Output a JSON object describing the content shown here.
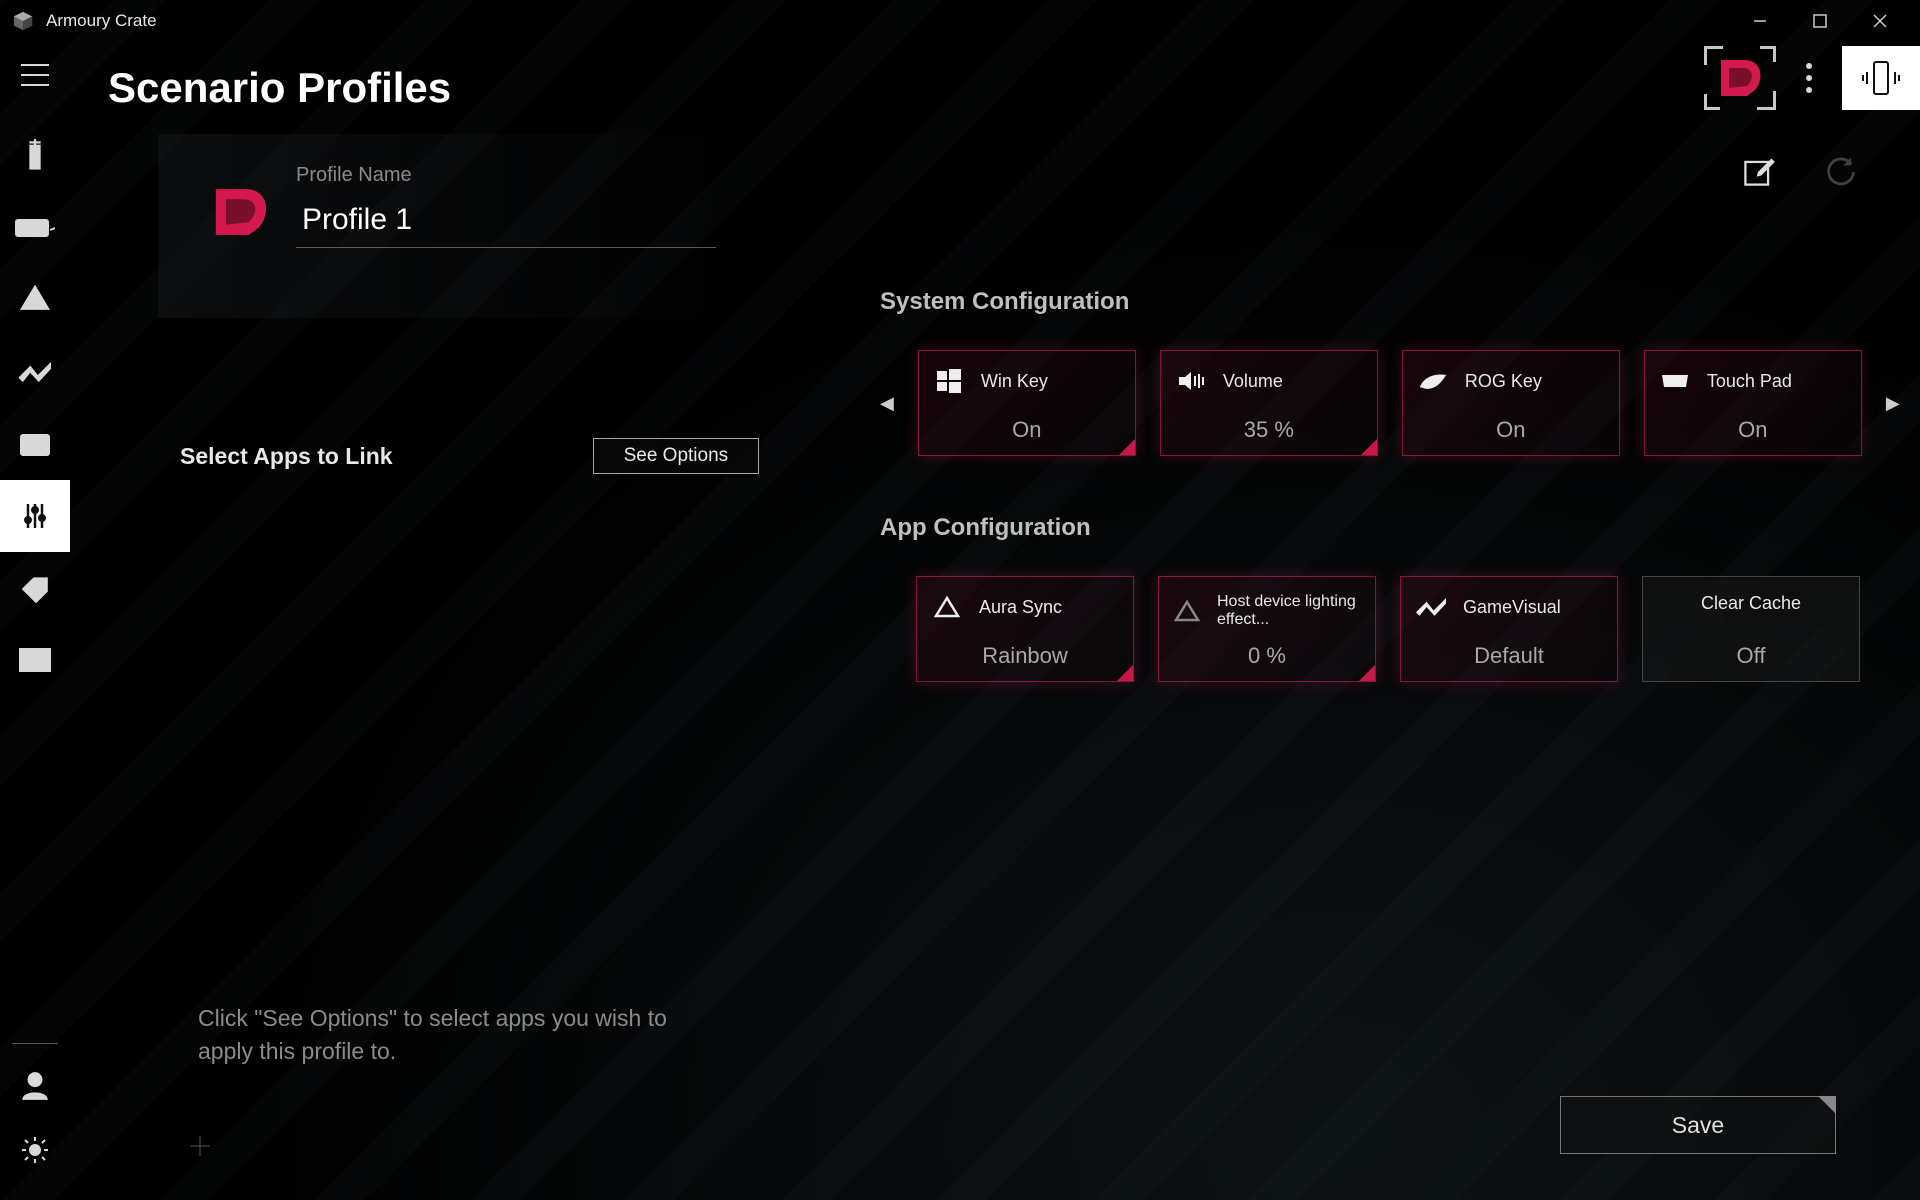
{
  "app": {
    "title": "Armoury Crate"
  },
  "page": {
    "heading": "Scenario Profiles"
  },
  "profile": {
    "name_label": "Profile Name",
    "name_value": "Profile 1",
    "apps_label": "Select Apps to Link",
    "see_options_label": "See Options",
    "helper_text": "Click \"See Options\" to select apps you wish to apply this profile to."
  },
  "system_config": {
    "title": "System Configuration",
    "cards": {
      "win_key": {
        "label": "Win Key",
        "value": "On"
      },
      "volume": {
        "label": "Volume",
        "value": "35 %"
      },
      "rog_key": {
        "label": "ROG Key",
        "value": "On"
      },
      "touchpad": {
        "label": "Touch Pad",
        "value": "On"
      }
    }
  },
  "app_config": {
    "title": "App Configuration",
    "cards": {
      "aura_sync": {
        "label": "Aura Sync",
        "value": "Rainbow"
      },
      "host_light": {
        "label": "Host device lighting effect...",
        "value": "0 %"
      },
      "gamevisual": {
        "label": "GameVisual",
        "value": "Default"
      },
      "clear_cache": {
        "label": "Clear Cache",
        "value": "Off"
      }
    }
  },
  "colors": {
    "accent": "#d6194d"
  },
  "actions": {
    "save_label": "Save"
  }
}
